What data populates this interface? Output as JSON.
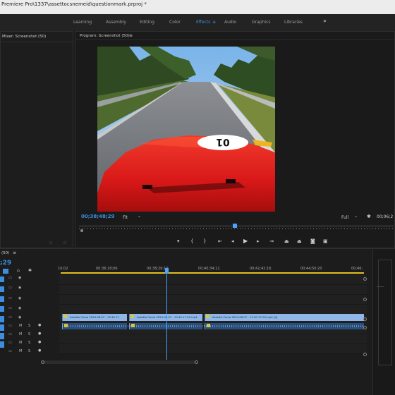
{
  "window": {
    "title": "Premiere Pro\\1337\\assettocsnemeid\\questionmark.prproj *"
  },
  "workspaces": [
    {
      "label": "Learning",
      "active": false
    },
    {
      "label": "Assembly",
      "active": false
    },
    {
      "label": "Editing",
      "active": false
    },
    {
      "label": "Color",
      "active": false
    },
    {
      "label": "Effects",
      "active": true
    },
    {
      "label": "Audio",
      "active": false
    },
    {
      "label": "Graphics",
      "active": false
    },
    {
      "label": "Libraries",
      "active": false
    }
  ],
  "workspaces_more": "»",
  "workspace_menu_icon": "≡",
  "mixer": {
    "title": "Mixer: Screenshot (50)"
  },
  "program": {
    "title": "Program: Screenshot (50)",
    "menu_icon": "≡",
    "timecode": "00;38;48;29",
    "fit": "Fit",
    "quality": "Full",
    "timecode_right": "00;06;2"
  },
  "transport_icons": [
    "marker-icon",
    "mark-in-icon",
    "mark-out-icon",
    "go-to-in-icon",
    "step-back-icon",
    "play-icon",
    "step-forward-icon",
    "go-to-out-icon",
    "lift-icon",
    "extract-icon",
    "export-frame-icon",
    "settings-icon"
  ],
  "timeline": {
    "tab": "(50)",
    "menu_icon": "≡",
    "timecode": ";29",
    "ruler": [
      "10;02",
      "00;36;18;06",
      "00;38;26;10",
      "00;40;34;12",
      "00;42;42;16",
      "00;44;50;20",
      "00;46;"
    ],
    "tracks": [
      {
        "name": "V3"
      },
      {
        "name": "V2"
      },
      {
        "name": "V1"
      },
      {
        "name": "A1"
      },
      {
        "name": "A2"
      },
      {
        "name": "A3"
      },
      {
        "name": "A4"
      }
    ],
    "clips": [
      {
        "label": "Assetto Corsa 2024.06.07 - 13.40.17"
      },
      {
        "label": "Assetto Corsa 2024.06.07 - 13.40.17.03.mp4"
      },
      {
        "label": "Assetto Corsa 2024.06.07 - 13.40.17.03.mp4 [V]"
      }
    ]
  },
  "colors": {
    "accent": "#3d8ee0",
    "clip_video": "#8fb6e6",
    "clip_audio": "#2a4e7a",
    "car_red": "#e01b1b",
    "playhead": "#4aa3ff"
  }
}
